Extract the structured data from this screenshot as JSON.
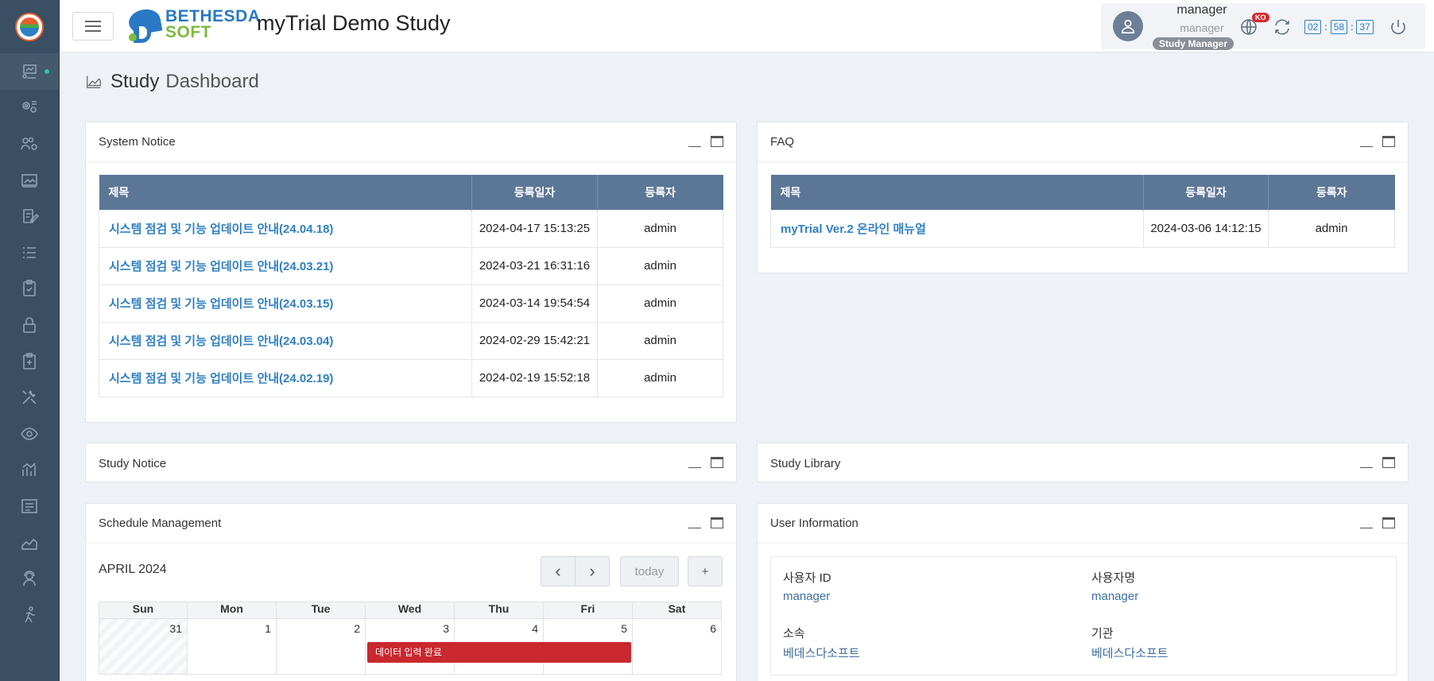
{
  "header": {
    "brand_line1": "BETHESDA",
    "brand_line2": "SOFT",
    "study_title": "myTrial Demo Study",
    "user_name": "manager",
    "user_id": "manager",
    "role": "Study Manager",
    "lang_badge": "KO",
    "timer": {
      "hours": "02",
      "minutes": "58",
      "seconds": "37"
    }
  },
  "page": {
    "title_strong": "Study",
    "title_light": "Dashboard"
  },
  "system_notice": {
    "title": "System Notice",
    "columns": [
      "제목",
      "등록일자",
      "등록자"
    ],
    "rows": [
      {
        "title": "시스템 점검 및 기능 업데이트 안내(24.04.18)",
        "date": "2024-04-17 15:13:25",
        "author": "admin"
      },
      {
        "title": "시스템 점검 및 기능 업데이트 안내(24.03.21)",
        "date": "2024-03-21 16:31:16",
        "author": "admin"
      },
      {
        "title": "시스템 점검 및 기능 업데이트 안내(24.03.15)",
        "date": "2024-03-14 19:54:54",
        "author": "admin"
      },
      {
        "title": "시스템 점검 및 기능 업데이트 안내(24.03.04)",
        "date": "2024-02-29 15:42:21",
        "author": "admin"
      },
      {
        "title": "시스템 점검 및 기능 업데이트 안내(24.02.19)",
        "date": "2024-02-19 15:52:18",
        "author": "admin"
      }
    ]
  },
  "faq": {
    "title": "FAQ",
    "columns": [
      "제목",
      "등록일자",
      "등록자"
    ],
    "rows": [
      {
        "title": "myTrial Ver.2 온라인 매뉴얼",
        "date": "2024-03-06 14:12:15",
        "author": "admin"
      }
    ]
  },
  "study_notice": {
    "title": "Study Notice"
  },
  "study_library": {
    "title": "Study Library"
  },
  "schedule": {
    "title": "Schedule Management",
    "month_label": "APRIL 2024",
    "today_label": "today",
    "add_label": "+",
    "prev_label": "‹",
    "next_label": "›",
    "weekdays": [
      "Sun",
      "Mon",
      "Tue",
      "Wed",
      "Thu",
      "Fri",
      "Sat"
    ],
    "first_week": [
      "31",
      "1",
      "2",
      "3",
      "4",
      "5",
      "6"
    ],
    "event": "데이터 입력 완료"
  },
  "user_info": {
    "title": "User Information",
    "id_label": "사용자 ID",
    "id_value": "manager",
    "name_label": "사용자명",
    "name_value": "manager",
    "affiliation_label": "소속",
    "affiliation_value": "베데스다소프트",
    "org_label": "기관",
    "org_value": "베데스다소프트"
  }
}
